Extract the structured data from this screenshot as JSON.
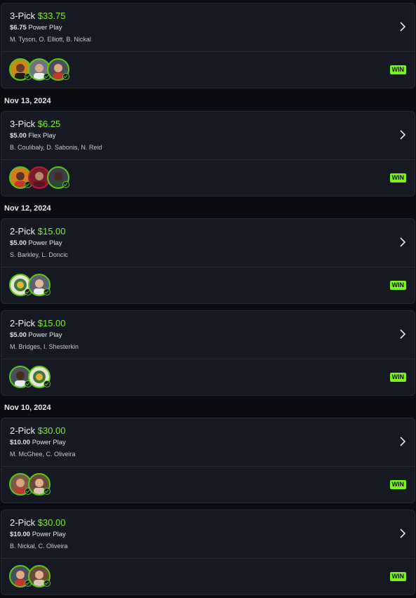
{
  "colors": {
    "accent": "#7cf21f",
    "background": "#0a0c12",
    "card": "#161822"
  },
  "dates": [
    "Nov 13, 2024",
    "Nov 12, 2024",
    "Nov 10, 2024"
  ],
  "cards": [
    {
      "pick": "3-Pick",
      "amount": "$33.75",
      "stake": "$6.75",
      "type": "Power Play",
      "players": "M. Tyson, O. Elliott, B. Nickal",
      "result": "WIN"
    },
    {
      "pick": "3-Pick",
      "amount": "$6.25",
      "stake": "$5.00",
      "type": "Flex Play",
      "players": "B. Coulibaly, D. Sabonis, N. Reid",
      "result": "WIN"
    },
    {
      "pick": "2-Pick",
      "amount": "$15.00",
      "stake": "$5.00",
      "type": "Power Play",
      "players": "S. Barkley, L. Doncic",
      "result": "WIN"
    },
    {
      "pick": "2-Pick",
      "amount": "$15.00",
      "stake": "$5.00",
      "type": "Power Play",
      "players": "M. Bridges, I. Shesterkin",
      "result": "WIN"
    },
    {
      "pick": "2-Pick",
      "amount": "$30.00",
      "stake": "$10.00",
      "type": "Power Play",
      "players": "M. McGhee, C. Oliveira",
      "result": "WIN"
    },
    {
      "pick": "2-Pick",
      "amount": "$30.00",
      "stake": "$10.00",
      "type": "Power Play",
      "players": "B. Nickal, C. Oliveira",
      "result": "WIN"
    }
  ]
}
